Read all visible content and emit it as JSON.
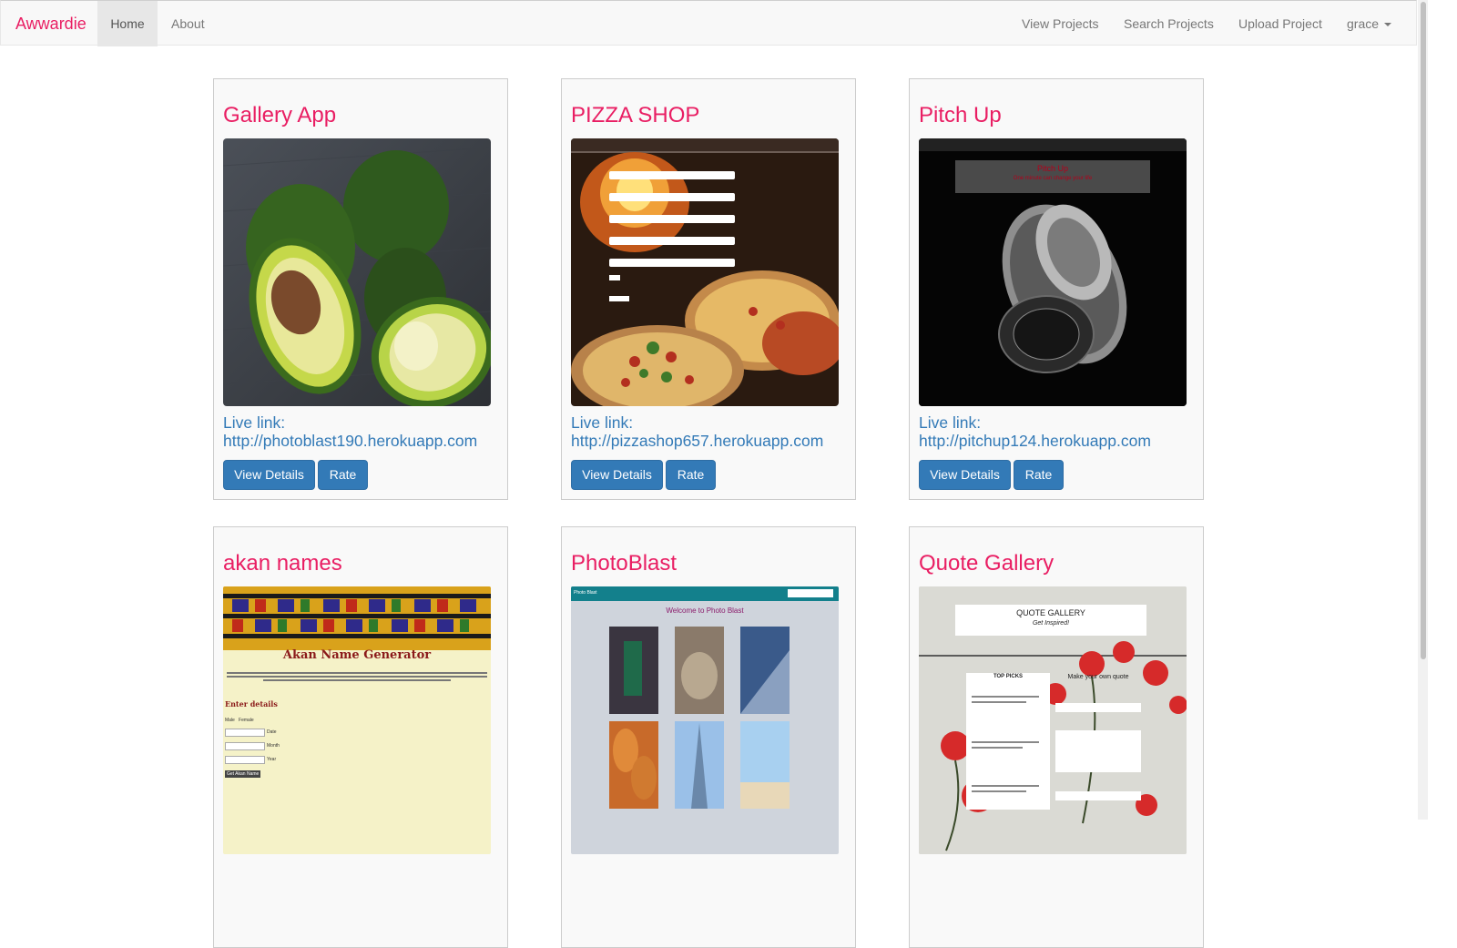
{
  "navbar": {
    "brand": "Awwardie",
    "left_links": [
      "Home",
      "About"
    ],
    "right_links": [
      "View Projects",
      "Search Projects",
      "Upload Project"
    ],
    "user": "grace"
  },
  "colors": {
    "brand": "#e91e63",
    "primary": "#337ab7",
    "link": "#337ab7"
  },
  "projects": [
    {
      "title": "Gallery App",
      "live_label": "Live link:",
      "url": "http://photoblast190.herokuapp.com",
      "view_label": "View Details",
      "rate_label": "Rate"
    },
    {
      "title": "PIZZA SHOP",
      "live_label": "Live link:",
      "url": "http://pizzashop657.herokuapp.com",
      "view_label": "View Details",
      "rate_label": "Rate"
    },
    {
      "title": "Pitch Up",
      "live_label": "Live link:",
      "url": "http://pitchup124.herokuapp.com",
      "view_label": "View Details",
      "rate_label": "Rate",
      "screenshot_text": [
        "Pitch Up",
        "One minute can change your life"
      ]
    },
    {
      "title": "akan names",
      "screenshot_text": [
        "Akan Name Generator",
        "Enter details",
        "Male",
        "Female",
        "Date",
        "Month",
        "Year",
        "Get Akan Name"
      ]
    },
    {
      "title": "PhotoBlast",
      "screenshot_text": [
        "Photo Blast",
        "Welcome to Photo Blast"
      ]
    },
    {
      "title": "Quote Gallery",
      "screenshot_text": [
        "QUOTE GALLERY",
        "Get Inspired!",
        "TOP PICKS",
        "Make your own quote"
      ]
    }
  ]
}
